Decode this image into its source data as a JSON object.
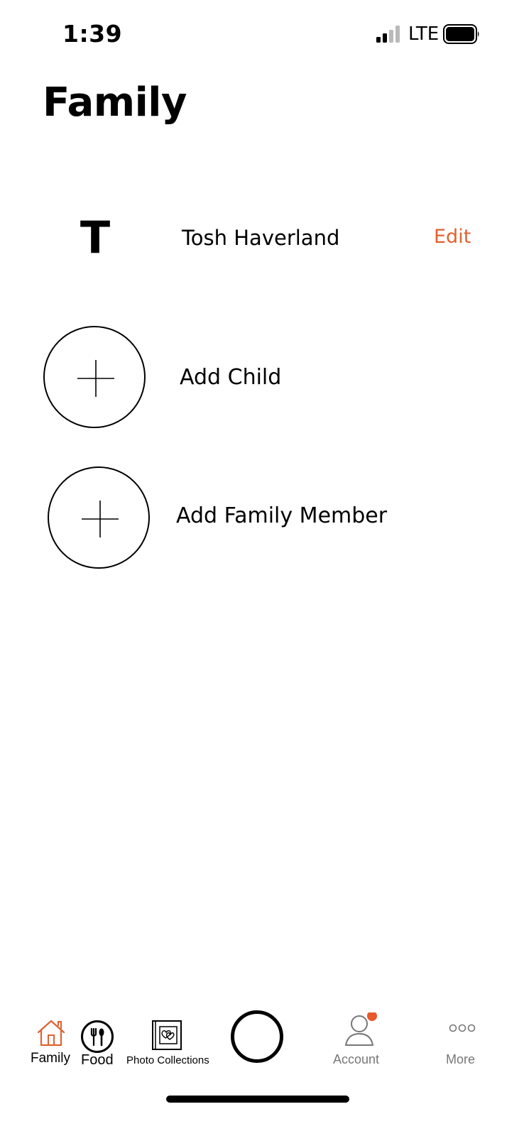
{
  "status_bar": {
    "time": "1:39",
    "carrier": "LTE"
  },
  "page": {
    "title": "Family"
  },
  "profile": {
    "initial": "T",
    "name": "Tosh Haverland",
    "edit_label": "Edit"
  },
  "actions": {
    "add_child": "Add Child",
    "add_family_member": "Add Family Member"
  },
  "tab_bar": {
    "family": "Family",
    "food": "Food",
    "photo_collections": "Photo Collections",
    "account": "Account",
    "more": "More"
  },
  "colors": {
    "accent": "#e06230",
    "inactive_tab": "#777777",
    "notification_dot": "#e8582a"
  }
}
